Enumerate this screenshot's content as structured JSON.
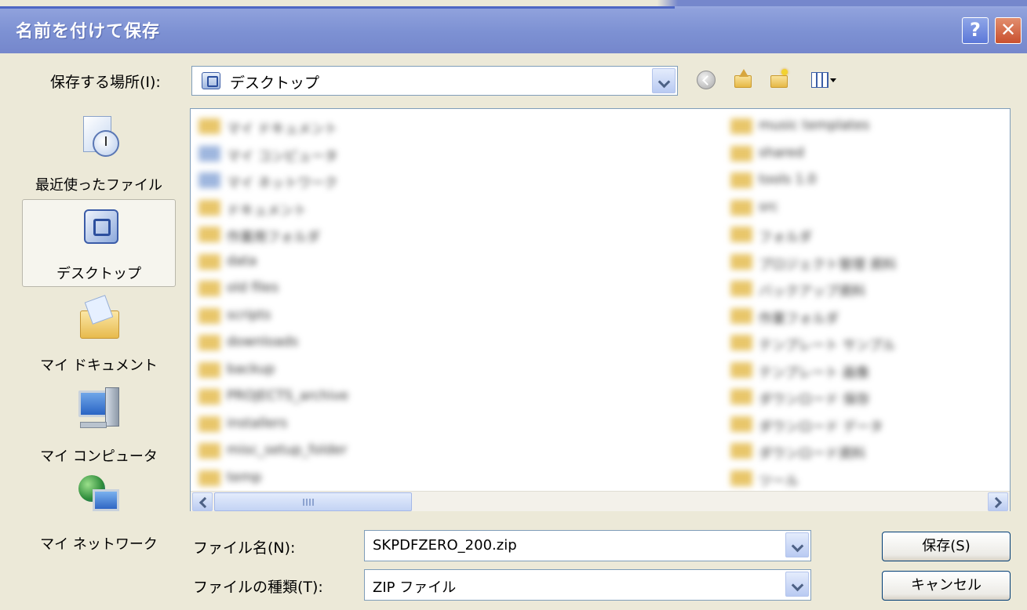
{
  "window": {
    "title": "名前を付けて保存",
    "help_glyph": "?",
    "close_glyph": "✕"
  },
  "savein": {
    "label": "保存する場所(I):",
    "value": "デスクトップ"
  },
  "toolbar": {
    "icons": [
      "back-icon",
      "up-folder-icon",
      "new-folder-icon",
      "views-menu-icon"
    ]
  },
  "places": [
    {
      "label": "最近使ったファイル",
      "icon": "recent-documents-icon"
    },
    {
      "label": "デスクトップ",
      "icon": "desktop-icon",
      "selected": true
    },
    {
      "label": "マイ ドキュメント",
      "icon": "my-documents-icon"
    },
    {
      "label": "マイ コンピュータ",
      "icon": "my-computer-icon"
    },
    {
      "label": "マイ ネットワーク",
      "icon": "my-network-icon"
    }
  ],
  "files": {
    "left": [
      {
        "name": "マイ ドキュメント",
        "type": "folder"
      },
      {
        "name": "マイ コンピュータ",
        "type": "system"
      },
      {
        "name": "マイ ネットワーク",
        "type": "system"
      },
      {
        "name": "ドキュメント",
        "type": "folder"
      },
      {
        "name": "作業用フォルダ",
        "type": "folder"
      },
      {
        "name": "data",
        "type": "folder"
      },
      {
        "name": "old files",
        "type": "folder"
      },
      {
        "name": "scripts",
        "type": "folder"
      },
      {
        "name": "downloads",
        "type": "folder"
      },
      {
        "name": "backup",
        "type": "folder"
      },
      {
        "name": "PROJECTS_archive",
        "type": "folder"
      },
      {
        "name": "installers",
        "type": "folder"
      },
      {
        "name": "misc_setup_folder",
        "type": "folder"
      },
      {
        "name": "temp",
        "type": "folder"
      }
    ],
    "right": [
      {
        "name": "music templates",
        "type": "folder"
      },
      {
        "name": "shared",
        "type": "folder"
      },
      {
        "name": "tools 1.0",
        "type": "folder"
      },
      {
        "name": "src",
        "type": "folder"
      },
      {
        "name": "フォルダ",
        "type": "folder"
      },
      {
        "name": "プロジェクト管理 資料",
        "type": "folder"
      },
      {
        "name": "バックアップ資料",
        "type": "folder"
      },
      {
        "name": "作業フォルダ",
        "type": "folder"
      },
      {
        "name": "テンプレート サンプル",
        "type": "folder"
      },
      {
        "name": "テンプレート 画像",
        "type": "folder"
      },
      {
        "name": "ダウンロード 保存",
        "type": "folder"
      },
      {
        "name": "ダウンロード データ",
        "type": "folder"
      },
      {
        "name": "ダウンロード資料",
        "type": "folder"
      },
      {
        "name": "ツール",
        "type": "folder"
      }
    ]
  },
  "filename": {
    "label": "ファイル名(N):",
    "value": "SKPDFZERO_200.zip"
  },
  "filetype": {
    "label": "ファイルの種類(T):",
    "value": "ZIP ファイル"
  },
  "buttons": {
    "save": "保存(S)",
    "cancel": "キャンセル"
  }
}
